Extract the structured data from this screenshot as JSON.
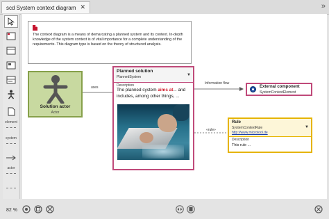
{
  "tab": {
    "title": "scd System context diagram",
    "close": "✕",
    "more": "»"
  },
  "palette": {
    "labels": {
      "element": "element",
      "system": "system",
      "actor": "actor"
    }
  },
  "note": {
    "text": "The context diagram is a means of demarcating a planned system and its context. In-depth knowledge of the system context is of vital importance for a complete understanding of the requirements. This diagram type is based on the theory of structured analysis."
  },
  "actor": {
    "name": "Solution actor",
    "type": "Actor"
  },
  "planned": {
    "title": "Planned solution",
    "type": "PlannedSystem",
    "desc_label": "Description",
    "desc_pre": "The planned system ",
    "desc_hl": "aims at",
    "desc_post": "... and includes, among other things, ..."
  },
  "connectors": {
    "uses": "uses",
    "information_flow": "Information flow",
    "rules": "«rule»"
  },
  "external": {
    "title": "External component",
    "type": "SystemContextElement"
  },
  "rule": {
    "title": "Rule",
    "type": "SystemContextRule",
    "link": "http://www.microtool.de",
    "desc_label": "Description",
    "desc": "This rule ..."
  },
  "status": {
    "zoom": "82 %"
  },
  "colors": {
    "actor_fill": "#c8d9a0",
    "actor_border": "#86a04a",
    "system_border": "#c04a7a",
    "rule_border": "#e6b400"
  }
}
